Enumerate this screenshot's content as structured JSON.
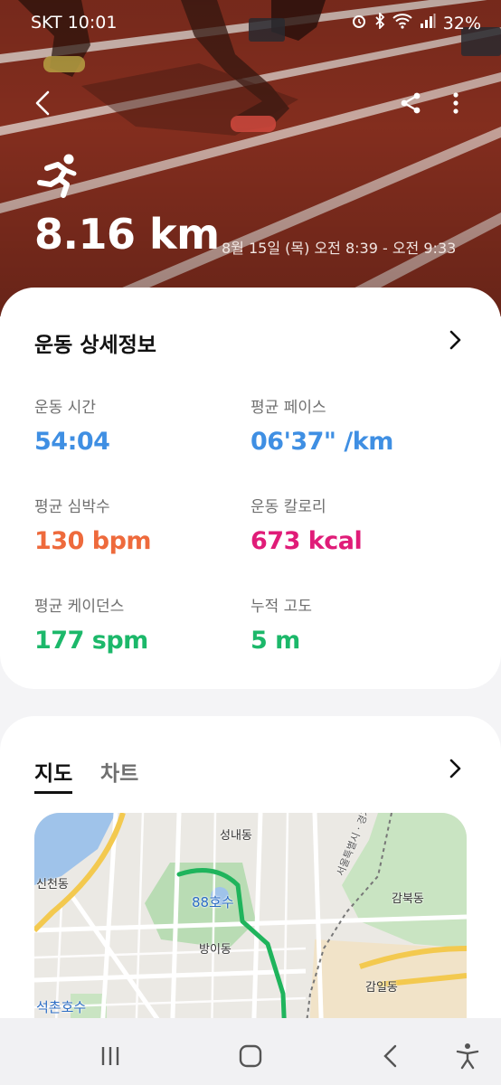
{
  "status": {
    "carrier_time": "SKT 10:01",
    "battery": "32%"
  },
  "header": {
    "back_icon": "chevron-left-icon",
    "share_icon": "share-icon",
    "more_icon": "more-vertical-icon",
    "activity_icon": "running-icon",
    "distance": "8.16 km",
    "time_range": "8월 15일 (목) 오전 8:39 - 오전 9:33"
  },
  "details": {
    "title": "운동 상세정보",
    "metrics": [
      {
        "label": "운동 시간",
        "value": "54:04",
        "color": "#3f8fe3"
      },
      {
        "label": "평균 페이스",
        "value": "06'37\" /km",
        "color": "#3f8fe3"
      },
      {
        "label": "평균 심박수",
        "value": "130 bpm",
        "color": "#ee6a3c"
      },
      {
        "label": "운동 칼로리",
        "value": "673 kcal",
        "color": "#e01c78"
      },
      {
        "label": "평균 케이던스",
        "value": "177 spm",
        "color": "#1cb86a"
      },
      {
        "label": "누적 고도",
        "value": "5 m",
        "color": "#1cb86a"
      }
    ]
  },
  "map_card": {
    "tabs": [
      {
        "label": "지도",
        "active": true
      },
      {
        "label": "차트",
        "active": false
      }
    ],
    "map_labels": {
      "seongnae": "성내동",
      "sincheon": "신천동",
      "lake88": "88호수",
      "bangi": "방이동",
      "gambuk": "감북동",
      "gamil": "감일동",
      "seokchon": "석촌호수",
      "boundary": "서울특별시 · 경기도"
    }
  },
  "navbar": {
    "recents_icon": "recent-apps-icon",
    "home_icon": "home-icon",
    "back_icon": "back-icon",
    "accessibility_icon": "accessibility-icon"
  }
}
